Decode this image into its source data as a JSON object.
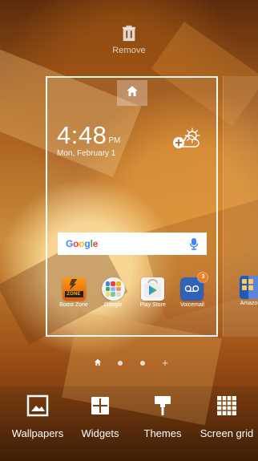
{
  "remove": {
    "label": "Remove",
    "icon": "trash-icon"
  },
  "home_preview": {
    "home_button_icon": "home-icon",
    "clock": {
      "time": "4:48",
      "meridiem": "PM",
      "date": "Mon, February 1"
    },
    "weather_icon": "weather-add-icon",
    "search": {
      "brand": "Google",
      "mic_icon": "microphone-icon"
    },
    "apps": [
      {
        "label": "Boost Zone",
        "icon": "boost-zone-icon"
      },
      {
        "label": "Google",
        "icon": "google-folder-icon"
      },
      {
        "label": "Play Store",
        "icon": "play-store-icon"
      },
      {
        "label": "Voicemail",
        "icon": "voicemail-icon",
        "badge": "3"
      }
    ],
    "next_preview_app": {
      "label": "Amazo",
      "icon": "amazon-folder-icon"
    }
  },
  "page_indicators": [
    {
      "type": "home",
      "icon": "home-indicator-icon"
    },
    {
      "type": "dot",
      "icon": "page-dot-icon"
    },
    {
      "type": "dot",
      "icon": "page-dot-icon"
    },
    {
      "type": "add",
      "label": "+"
    }
  ],
  "bottom_actions": [
    {
      "label": "Wallpapers",
      "icon": "wallpaper-icon"
    },
    {
      "label": "Widgets",
      "icon": "widgets-icon"
    },
    {
      "label": "Themes",
      "icon": "themes-icon"
    },
    {
      "label": "Screen grid",
      "icon": "screen-grid-icon"
    }
  ],
  "colors": {
    "google_blue": "#4285F4",
    "google_red": "#EA4335",
    "google_yellow": "#FBBC05",
    "google_green": "#34A853",
    "voicemail_blue": "#2F63B8",
    "badge_orange": "#F17D20"
  }
}
